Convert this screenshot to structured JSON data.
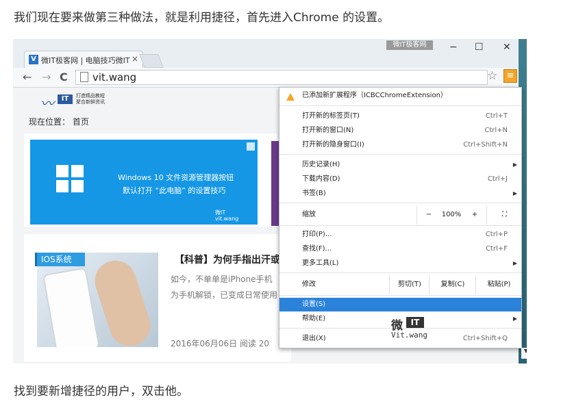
{
  "paragraph_top": "我们现在要来做第三种做法，就是利用捷径，首先进入Chrome 的设置。",
  "paragraph_bottom": "找到要新增捷径的用户，双击他。",
  "browser": {
    "tab_favicon": "V",
    "tab_title": "微IT极客网 | 电脑技巧微IT",
    "tab_close": "×",
    "watermark_top": "微IT极客网",
    "window_controls": {
      "minimize": "−",
      "maximize": "☐",
      "close": "✕"
    },
    "nav": {
      "back": "←",
      "forward": "→",
      "reload": "C"
    },
    "url": "vit.wang",
    "star": "☆",
    "menu_icon": "≡"
  },
  "site": {
    "logo_it": "IT",
    "logo_tagline_1": "打造精品教程",
    "logo_tagline_2": "聚合新鲜资讯",
    "breadcrumb": "现在位置：  首页",
    "banner_line1": "Windows 10 文件资源管理器按钮",
    "banner_line2": "默认打开 “此电脑” 的设置技巧",
    "banner_brand": "微IT\nvit.wang",
    "tag": "IOS系统",
    "headline": "【科普】为何手指出汗或",
    "excerpt_1": "如今，不单单是iPhone手机",
    "excerpt_2": "为手机解锁，已变成日常使用",
    "meta": "2016年06月06日  阅读 20"
  },
  "menu": {
    "extension_notice": "已添加新扩展程序（ICBCChromeExtension）",
    "items_group1": [
      {
        "label": "打开新的标签页(T)",
        "shortcut": "Ctrl+T"
      },
      {
        "label": "打开新的窗口(N)",
        "shortcut": "Ctrl+N"
      },
      {
        "label": "打开新的隐身窗口(I)",
        "shortcut": "Ctrl+Shift+N"
      }
    ],
    "history": "历史记录(H)",
    "downloads": "下载内容(D)",
    "downloads_shortcut": "Ctrl+J",
    "bookmarks": "书签(B)",
    "zoom_label": "缩放",
    "zoom_minus": "−",
    "zoom_value": "100%",
    "zoom_plus": "+",
    "fullscreen": "⛶",
    "print": "打印(P)...",
    "print_shortcut": "Ctrl+P",
    "find": "查找(F)...",
    "find_shortcut": "Ctrl+F",
    "more_tools": "更多工具(L)",
    "edit_label": "修改",
    "cut": "剪切(T)",
    "copy": "复制(C)",
    "paste": "粘贴(P)",
    "settings": "设置(S)",
    "help": "帮助(E)",
    "exit": "退出(X)",
    "exit_shortcut": "Ctrl+Shift+Q",
    "watermark_brand": "微",
    "watermark_it": "IT",
    "watermark_site": "Vit.wang"
  }
}
